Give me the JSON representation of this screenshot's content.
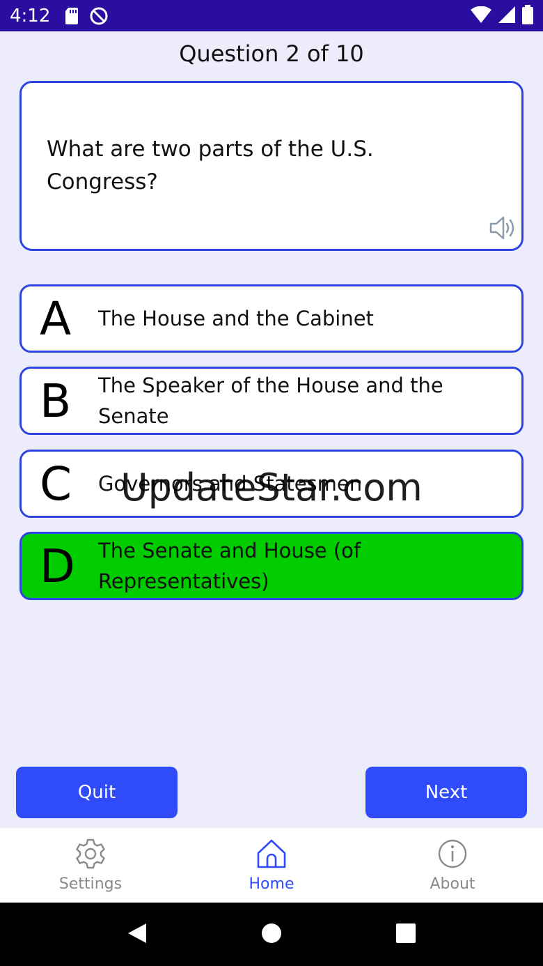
{
  "status_bar": {
    "time": "4:12",
    "icons_left": [
      "sd-card-icon",
      "do-not-disturb-icon"
    ],
    "icons_right": [
      "wifi-icon",
      "signal-icon",
      "battery-icon"
    ]
  },
  "quiz": {
    "counter": "Question 2 of 10",
    "question": "What are two parts of the U.S. Congress?",
    "answers": [
      {
        "letter": "A",
        "text": "The House and the Cabinet",
        "correct": false
      },
      {
        "letter": "B",
        "text": "The Speaker of the House and the Senate",
        "correct": false
      },
      {
        "letter": "C",
        "text": "Governors and Statesmen",
        "correct": false
      },
      {
        "letter": "D",
        "text": "The Senate and House (of Representatives)",
        "correct": true
      }
    ]
  },
  "watermark": "UpdateStar.com",
  "buttons": {
    "quit": "Quit",
    "next": "Next"
  },
  "nav": {
    "settings": "Settings",
    "home": "Home",
    "about": "About",
    "active": "home"
  },
  "colors": {
    "accent": "#2f4bfa",
    "status_bar": "#2a0ea0",
    "correct": "#00cc00",
    "border": "#2e44e0",
    "background": "#ececfa"
  }
}
